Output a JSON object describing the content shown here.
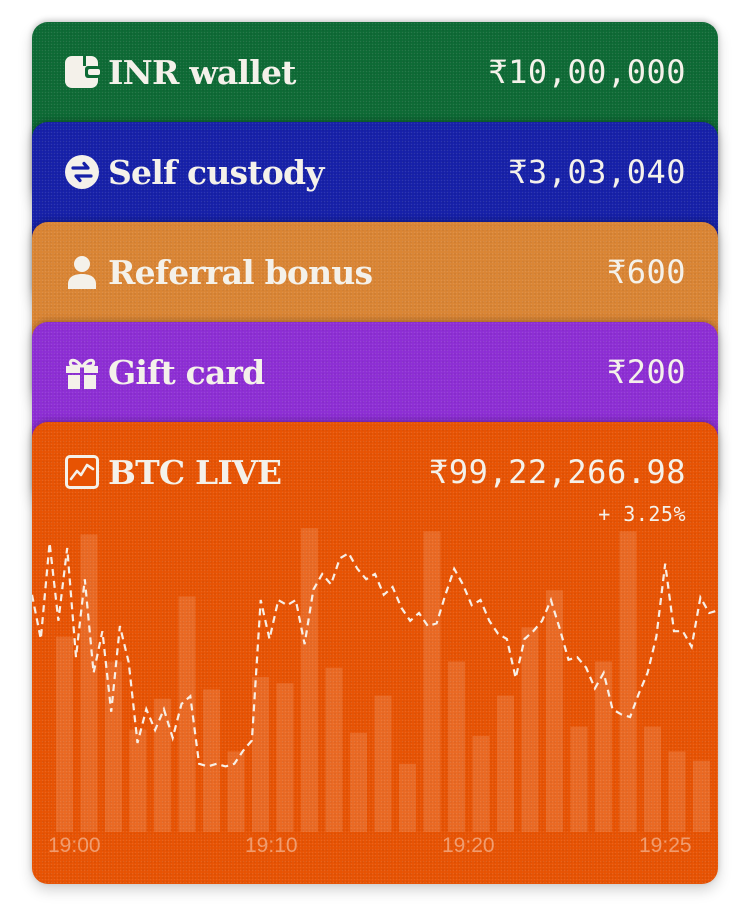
{
  "cards": [
    {
      "label": "INR wallet",
      "amount": "₹10,00,000",
      "icon": "wallet-icon",
      "color": "#0d6a35"
    },
    {
      "label": "Self custody",
      "amount": "₹3,03,040",
      "icon": "swap-icon",
      "color": "#1620a8"
    },
    {
      "label": "Referral bonus",
      "amount": "₹600",
      "icon": "person-icon",
      "color": "#da8534"
    },
    {
      "label": "Gift card",
      "amount": "₹200",
      "icon": "gift-icon",
      "color": "#8d2ed4"
    }
  ],
  "btc": {
    "label": "BTC LIVE",
    "amount": "₹99,22,266.98",
    "change": "+ 3.25%",
    "icon": "chart-line-icon",
    "color": "#e75303"
  },
  "chart_data": {
    "type": "line",
    "xlabels": [
      "19:00",
      "19:10",
      "19:20",
      "19:25"
    ],
    "line": [
      72,
      55,
      92,
      62,
      90,
      48,
      78,
      42,
      58,
      27,
      60,
      46,
      15,
      28,
      20,
      28,
      17,
      30,
      33,
      7,
      6,
      7,
      6,
      7,
      12,
      16,
      70,
      55,
      70,
      68,
      70,
      53,
      74,
      80,
      76,
      86,
      88,
      82,
      78,
      80,
      72,
      75,
      67,
      62,
      65,
      60,
      61,
      72,
      82,
      76,
      68,
      70,
      62,
      57,
      55,
      40,
      55,
      58,
      62,
      70,
      59,
      47,
      48,
      44,
      36,
      42,
      28,
      26,
      25,
      34,
      42,
      56,
      84,
      58,
      58,
      52,
      71,
      65,
      66
    ],
    "volume": [
      63,
      96,
      55,
      33,
      43,
      76,
      46,
      26,
      50,
      48,
      98,
      53,
      32,
      44,
      22,
      97,
      55,
      31,
      44,
      66,
      78,
      34,
      55,
      97,
      34,
      26,
      23,
      50,
      61,
      40
    ],
    "change_pct": "+ 3.25%"
  }
}
